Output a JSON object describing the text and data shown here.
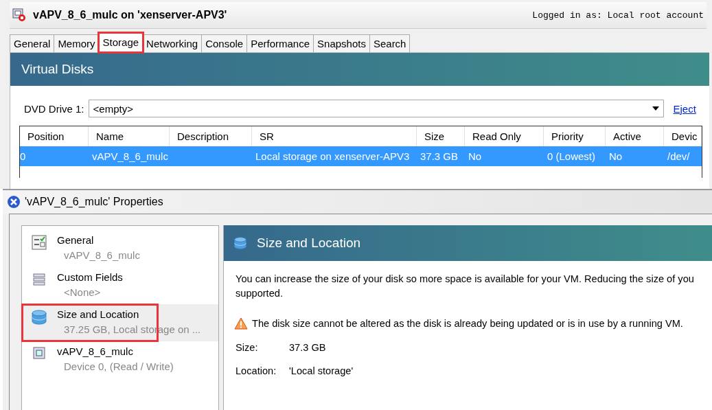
{
  "window": {
    "title": "vAPV_8_6_mulc on 'xenserver-APV3'",
    "login": "Logged in as: Local root account"
  },
  "tabs": [
    {
      "label": "General",
      "selected": false,
      "highlighted": false
    },
    {
      "label": "Memory",
      "selected": false,
      "highlighted": false
    },
    {
      "label": "Storage",
      "selected": true,
      "highlighted": true
    },
    {
      "label": "Networking",
      "selected": false,
      "highlighted": false
    },
    {
      "label": "Console",
      "selected": false,
      "highlighted": false
    },
    {
      "label": "Performance",
      "selected": false,
      "highlighted": false
    },
    {
      "label": "Snapshots",
      "selected": false,
      "highlighted": false
    },
    {
      "label": "Search",
      "selected": false,
      "highlighted": false
    }
  ],
  "panel": {
    "title": "Virtual Disks",
    "dvd_label": "DVD Drive 1:",
    "dvd_value": "<empty>",
    "eject": "Eject"
  },
  "table": {
    "columns": [
      "Position",
      "Name",
      "Description",
      "SR",
      "Size",
      "Read Only",
      "Priority",
      "Active",
      "Devic"
    ],
    "rows": [
      {
        "selected": true,
        "cells": [
          "0",
          "vAPV_8_6_mulc",
          "",
          "Local storage on xenserver-APV3",
          "37.3 GB",
          "No",
          "0 (Lowest)",
          "No",
          "/dev/"
        ]
      }
    ]
  },
  "dialog": {
    "title": "'vAPV_8_6_mulc' Properties",
    "sidebar": {
      "items": [
        {
          "kind": "general",
          "title": "General",
          "subtitle": "vAPV_8_6_mulc",
          "selected": false,
          "highlighted": false
        },
        {
          "kind": "fields",
          "title": "Custom Fields",
          "subtitle": "<None>",
          "selected": false,
          "highlighted": false
        },
        {
          "kind": "disk",
          "title": "Size and Location",
          "subtitle": "37.25 GB, Local storage on ...",
          "selected": true,
          "highlighted": true
        },
        {
          "kind": "device",
          "title": "vAPV_8_6_mulc",
          "subtitle": "Device 0, (Read / Write)",
          "selected": false,
          "highlighted": false
        }
      ]
    },
    "page": {
      "title": "Size and Location",
      "description_lines": [
        "You can increase the size of your disk so more space is available for your VM. Reducing the size of you",
        "supported."
      ],
      "warning": "The disk size cannot be altered as the disk is already being updated or is in use by a running VM.",
      "fields": [
        {
          "label": "Size:",
          "value": "37.3 GB"
        },
        {
          "label": "Location:",
          "value": "'Local storage'"
        }
      ]
    }
  }
}
